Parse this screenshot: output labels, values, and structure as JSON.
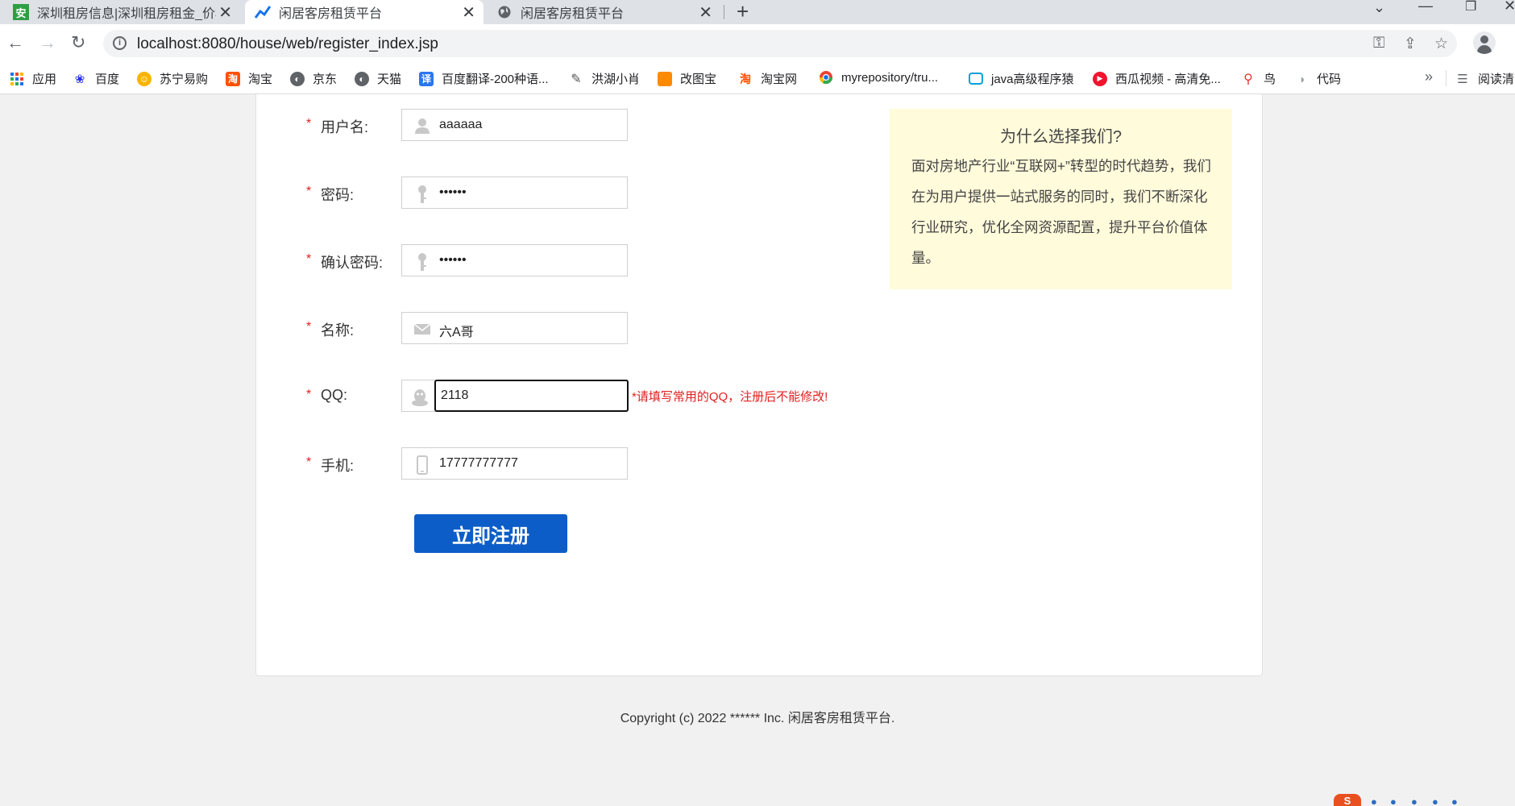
{
  "browser": {
    "tabs": [
      {
        "label": "深圳租房信息|深圳租房租金_价格",
        "icon": "安",
        "active": false
      },
      {
        "label": "闲居客房租赁平台",
        "icon": "chart-icon",
        "active": true
      },
      {
        "label": "闲居客房租赁平台",
        "icon": "globe-icon",
        "active": false
      }
    ],
    "new_tab": "+",
    "url": "localhost:8080/house/web/register_index.jsp",
    "bookmarks": [
      {
        "label": "应用",
        "icon": "apps-grid-icon"
      },
      {
        "label": "百度",
        "icon": "baidu-paw-icon"
      },
      {
        "label": "苏宁易购",
        "icon": "suning-icon"
      },
      {
        "label": "淘宝",
        "icon": "taobao-icon"
      },
      {
        "label": "京东",
        "icon": "globe-icon"
      },
      {
        "label": "天猫",
        "icon": "globe-icon"
      },
      {
        "label": "百度翻译-200种语...",
        "icon": "translate-icon"
      },
      {
        "label": "洪湖小肖",
        "icon": "pen-icon"
      },
      {
        "label": "改图宝",
        "icon": "gaitubao-icon"
      },
      {
        "label": "淘宝网",
        "icon": "taobao-icon"
      },
      {
        "label": "myrepository/tru...",
        "icon": "chrome-icon"
      },
      {
        "label": "java高级程序猿",
        "icon": "bilibili-icon"
      },
      {
        "label": "西瓜视频 - 高清免...",
        "icon": "xigua-icon"
      },
      {
        "label": "鸟",
        "icon": "bird-icon"
      },
      {
        "label": "代码",
        "icon": "code-icon"
      }
    ],
    "bookmarks_more": "»",
    "reading_list": "阅读清"
  },
  "form": {
    "fields": [
      {
        "label": "用户名:",
        "value": "aaaaaa",
        "icon": "user-icon"
      },
      {
        "label": "密码:",
        "value": "••••••",
        "icon": "key-icon"
      },
      {
        "label": "确认密码:",
        "value": "••••••",
        "icon": "key-icon"
      },
      {
        "label": "名称:",
        "value": "六A哥",
        "icon": "envelope-icon"
      },
      {
        "label": "QQ:",
        "value": "2118",
        "icon": "qq-penguin-icon"
      },
      {
        "label": "手机:",
        "value": "17777777777",
        "icon": "phone-icon"
      }
    ],
    "required_mark": "*",
    "qq_hint": "*请填写常用的QQ，注册后不能修改!",
    "submit_label": "立即注册"
  },
  "why": {
    "title": "为什么选择我们?",
    "body": "面对房地产行业“互联网+”转型的时代趋势，我们在为用户提供一站式服务的同时，我们不断深化行业研究，优化全网资源配置，提升平台价值体量。"
  },
  "footer": {
    "copyright": "Copyright (c) 2022 ****** Inc. 闲居客房租赁平台."
  },
  "colors": {
    "accent": "#0d5dc8",
    "required": "#e02020",
    "why_bg": "#fffbdb"
  }
}
